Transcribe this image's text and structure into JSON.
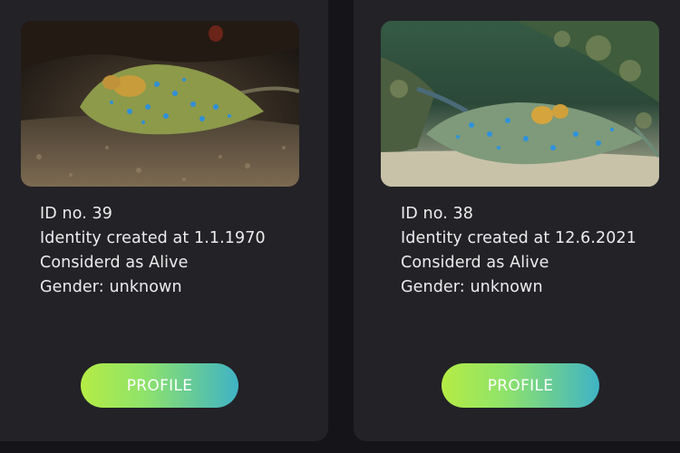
{
  "cards": [
    {
      "id_line": "ID no. 39",
      "created_line": "Identity created at 1.1.1970",
      "status_line": "Considerd as Alive",
      "gender_line": "Gender: unknown",
      "button_label": "PROFILE"
    },
    {
      "id_line": "ID no. 38",
      "created_line": "Identity created at 12.6.2021",
      "status_line": "Considerd as Alive",
      "gender_line": "Gender: unknown",
      "button_label": "PROFILE"
    }
  ],
  "colors": {
    "page_background": "#151519",
    "card_background": "#232227",
    "text": "#ececec",
    "button_gradient_start": "#b5ec45",
    "button_gradient_end": "#3fb3c5"
  }
}
